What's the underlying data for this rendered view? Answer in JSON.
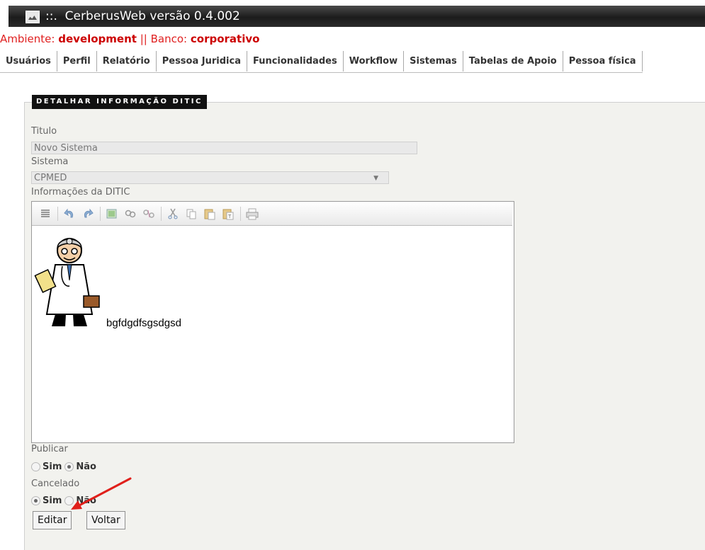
{
  "app": {
    "title": "::.  CerberusWeb versão 0.4.002"
  },
  "env": {
    "ambiente_label": "Ambiente:",
    "ambiente_value": "development",
    "separator": "||",
    "banco_label": "Banco:",
    "banco_value": "corporativo"
  },
  "nav": {
    "items": [
      "Usuários",
      "Perfil",
      "Relatório",
      "Pessoa Juridica",
      "Funcionalidades",
      "Workflow",
      "Sistemas",
      "Tabelas de Apoio",
      "Pessoa física"
    ]
  },
  "form": {
    "legend": "DETALHAR INFORMAÇÃO DITIC",
    "titulo_label": "Titulo",
    "titulo_value": "Novo Sistema",
    "sistema_label": "Sistema",
    "sistema_value": "CPMED",
    "info_label": "Informações da DITIC",
    "editor_text": "bgfdgdfsgsdgsd",
    "publicar_label": "Publicar",
    "publicar_options": [
      "Sim",
      "Não"
    ],
    "publicar_selected": "Não",
    "cancelado_label": "Cancelado",
    "cancelado_options": [
      "Sim",
      "Não"
    ],
    "cancelado_selected": "Sim",
    "editar_label": "Editar",
    "voltar_label": "Voltar"
  },
  "colors": {
    "env_text": "#e02020",
    "titlebar": "#2a2a2a",
    "annotation_arrow": "#e0201b"
  },
  "icons": [
    "source-icon",
    "undo-icon",
    "redo-icon",
    "image-icon",
    "link-icon",
    "unlink-icon",
    "cut-icon",
    "copy-icon",
    "paste-icon",
    "paste-text-icon",
    "print-icon"
  ]
}
